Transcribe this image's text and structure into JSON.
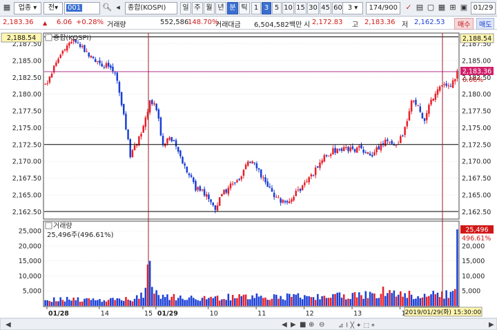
{
  "toolbar": {
    "market_select": "업종",
    "type_select": "전",
    "code": "001",
    "index_name": "종합(KOSPI)",
    "periods": [
      "일",
      "주",
      "월",
      "년",
      "분",
      "틱"
    ],
    "active_period": "분",
    "intervals": [
      "1",
      "3",
      "5",
      "10",
      "15",
      "30",
      "45",
      "60"
    ],
    "active_interval": "3",
    "interval_input": "3",
    "count": "174/900",
    "date": "01/29"
  },
  "info": {
    "price": "2,183.36",
    "change": "6.06",
    "change_pct": "+0.28%",
    "volume_label": "거래량",
    "volume": "552,586",
    "volume_ratio": "148.70%",
    "amount_label": "거래대금",
    "amount": "6,504,582백만",
    "open_label": "시",
    "open": "2,172.83",
    "high_label": "고",
    "high": "2,183.36",
    "low_label": "저",
    "low": "2,162.53",
    "buy_label": "매수",
    "sell_label": "매도"
  },
  "price_panel": {
    "title": "종합(KOSPI)",
    "left_label_top": "2,188.54",
    "right_label_top": "2,188.54",
    "right_label_current": "2,183.36",
    "right_label_pct": "0.06%",
    "y_ticks": [
      "2,187.50",
      "2,185.00",
      "2,182.50",
      "2,180.00",
      "2,177.50",
      "2,175.00",
      "2,172.50",
      "2,170.00",
      "2,167.50",
      "2,165.00",
      "2,162.50"
    ]
  },
  "volume_panel": {
    "title": "거래량",
    "readout": "25,496주(496.61%)",
    "right_label_current": "25,496",
    "right_label_pct": "496.61%",
    "y_ticks": [
      "25,000",
      "20,000",
      "15,000",
      "10,000",
      "5,000"
    ]
  },
  "x_axis": {
    "labels": [
      "01/28",
      "14",
      "15",
      "01/29",
      "10",
      "11",
      "12",
      "13",
      "14"
    ],
    "cursor_readout": "2019/01/29(화) 15:30:00"
  },
  "colors": {
    "up": "#e8202a",
    "down": "#1a3fd6",
    "cursor": "#9b1f2a",
    "hline": "#000000",
    "current": "#b0308a"
  },
  "chart_data": {
    "type": "candlestick",
    "price_ylim": [
      2161.5,
      2189.0
    ],
    "volume_ylim": [
      0,
      28000
    ],
    "horizontal_lines": [
      2188.54,
      2172.5,
      2162.53
    ],
    "current_line": 2183.36,
    "anchors": [
      [
        0,
        2181.5
      ],
      [
        3,
        2183
      ],
      [
        6,
        2185.5
      ],
      [
        9,
        2187
      ],
      [
        12,
        2188
      ],
      [
        15,
        2187.5
      ],
      [
        18,
        2186.5
      ],
      [
        22,
        2185.5
      ],
      [
        26,
        2184.5
      ],
      [
        30,
        2184
      ],
      [
        33,
        2182
      ],
      [
        36,
        2177
      ],
      [
        39,
        2171
      ],
      [
        42,
        2173
      ],
      [
        45,
        2175
      ],
      [
        48,
        2179
      ],
      [
        51,
        2178
      ],
      [
        54,
        2172
      ],
      [
        57,
        2174
      ],
      [
        60,
        2172
      ],
      [
        63,
        2170
      ],
      [
        66,
        2168
      ],
      [
        69,
        2166
      ],
      [
        72,
        2166
      ],
      [
        75,
        2164
      ],
      [
        78,
        2163
      ],
      [
        81,
        2165
      ],
      [
        84,
        2166
      ],
      [
        87,
        2167
      ],
      [
        90,
        2168
      ],
      [
        93,
        2170
      ],
      [
        96,
        2170
      ],
      [
        99,
        2168
      ],
      [
        102,
        2166
      ],
      [
        105,
        2165
      ],
      [
        108,
        2164
      ],
      [
        111,
        2164
      ],
      [
        114,
        2165
      ],
      [
        117,
        2166
      ],
      [
        120,
        2167
      ],
      [
        123,
        2168
      ],
      [
        126,
        2170
      ],
      [
        129,
        2171
      ],
      [
        132,
        2171.5
      ],
      [
        135,
        2172
      ],
      [
        138,
        2172
      ],
      [
        141,
        2171.5
      ],
      [
        144,
        2172
      ],
      [
        147,
        2171
      ],
      [
        150,
        2171
      ],
      [
        153,
        2172
      ],
      [
        156,
        2173
      ],
      [
        159,
        2173
      ],
      [
        162,
        2172.5
      ],
      [
        165,
        2175
      ],
      [
        168,
        2179
      ],
      [
        171,
        2178
      ],
      [
        174,
        2176
      ],
      [
        177,
        2179
      ],
      [
        180,
        2181
      ],
      [
        183,
        2181.5
      ],
      [
        186,
        2181
      ],
      [
        189,
        2183.36
      ]
    ],
    "volume_anchors": [
      [
        0,
        2000
      ],
      [
        10,
        2200
      ],
      [
        20,
        2000
      ],
      [
        30,
        2100
      ],
      [
        40,
        2300
      ],
      [
        45,
        3500
      ],
      [
        48,
        15000
      ],
      [
        49,
        6000
      ],
      [
        50,
        4000
      ],
      [
        55,
        3500
      ],
      [
        60,
        3000
      ],
      [
        70,
        2800
      ],
      [
        80,
        2900
      ],
      [
        90,
        3100
      ],
      [
        100,
        3000
      ],
      [
        110,
        3200
      ],
      [
        120,
        3100
      ],
      [
        130,
        3300
      ],
      [
        140,
        3500
      ],
      [
        150,
        3600
      ],
      [
        155,
        4800
      ],
      [
        160,
        3800
      ],
      [
        170,
        3700
      ],
      [
        180,
        3900
      ],
      [
        186,
        4000
      ],
      [
        188,
        5000
      ],
      [
        189,
        25496
      ]
    ]
  }
}
